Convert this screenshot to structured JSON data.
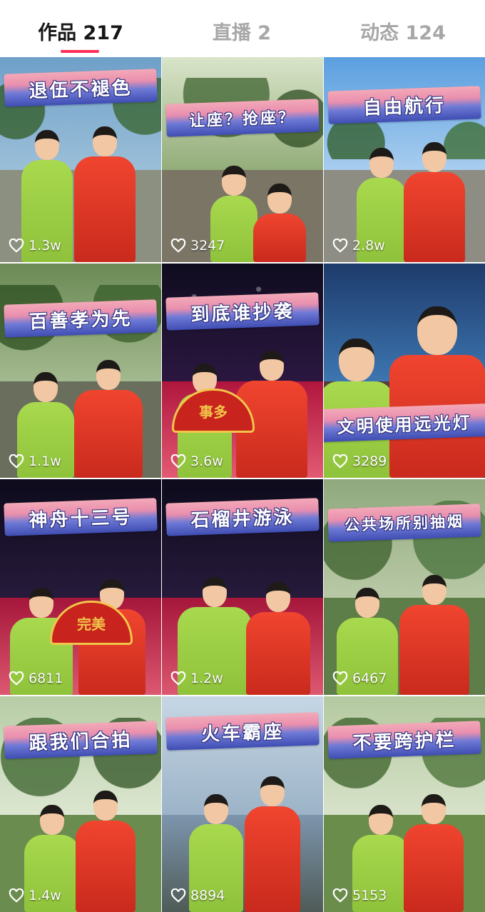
{
  "tabs": [
    {
      "label": "作品 217",
      "active": true
    },
    {
      "label": "直播 2",
      "active": false
    },
    {
      "label": "动态 124",
      "active": false
    }
  ],
  "accent_color": "#ff2c55",
  "videos": [
    {
      "title": "退伍不褪色",
      "likes": "1.3w",
      "scene": "outdoor",
      "fan": ""
    },
    {
      "title": "让座？抢座？",
      "likes": "3247",
      "scene": "outdoor",
      "fan": ""
    },
    {
      "title": "自由航行",
      "likes": "2.8w",
      "scene": "outdoor",
      "fan": ""
    },
    {
      "title": "百善孝为先",
      "likes": "1.1w",
      "scene": "outdoor",
      "fan": ""
    },
    {
      "title": "到底谁抄袭",
      "likes": "3.6w",
      "scene": "stage",
      "fan": "事多"
    },
    {
      "title": "文明使用远光灯",
      "likes": "3289",
      "scene": "city",
      "fan": ""
    },
    {
      "title": "神舟十三号",
      "likes": "6811",
      "scene": "stage",
      "fan": "完美"
    },
    {
      "title": "石榴井游泳",
      "likes": "1.2w",
      "scene": "stage",
      "fan": ""
    },
    {
      "title": "公共场所别抽烟",
      "likes": "6467",
      "scene": "outdoor",
      "fan": ""
    },
    {
      "title": "跟我们合拍",
      "likes": "1.4w",
      "scene": "outdoor",
      "fan": ""
    },
    {
      "title": "火车霸座",
      "likes": "8894",
      "scene": "lake",
      "fan": ""
    },
    {
      "title": "不要跨护栏",
      "likes": "5153",
      "scene": "outdoor",
      "fan": ""
    }
  ]
}
